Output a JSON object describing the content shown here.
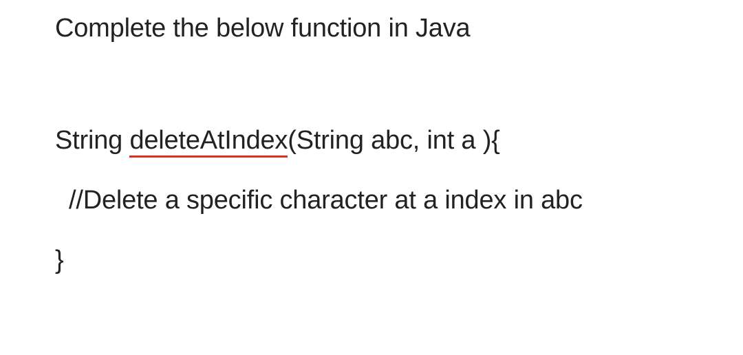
{
  "prompt": "Complete the below function in Java",
  "code": {
    "signature_prefix": "String ",
    "function_name": "deleteAtIndex",
    "signature_suffix": "(String abc, int a ){",
    "comment": "//Delete a specific character at a index in abc",
    "closing_brace": "}"
  }
}
